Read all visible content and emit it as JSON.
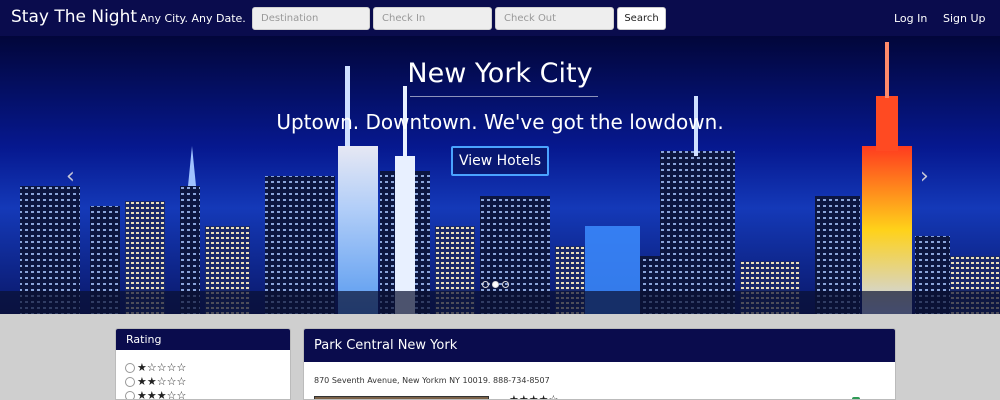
{
  "navbar": {
    "brand": "Stay The Night",
    "tagline": "Any City. Any Date.",
    "destination_placeholder": "Destination",
    "checkin_placeholder": "Check In",
    "checkout_placeholder": "Check Out",
    "search_label": "Search",
    "login_label": "Log In",
    "signup_label": "Sign Up"
  },
  "hero": {
    "title": "New York City",
    "subtitle": "Uptown. Downtown. We've got the lowdown.",
    "button_label": "View Hotels",
    "prev_arrow": "‹",
    "next_arrow": "›",
    "slides_count": 3,
    "active_slide": 1
  },
  "rating_filter": {
    "title": "Rating",
    "options": [
      "★☆☆☆☆",
      "★★☆☆☆",
      "★★★☆☆"
    ]
  },
  "hotel": {
    "name": "Park Central New York",
    "address": "870 Seventh Avenue, New Yorkm NY 10019. 888-734-8507",
    "stars": "★★★★☆"
  },
  "colors": {
    "nav_bg": "#0a0c4d",
    "page_bg": "#cfcfcf",
    "accent_button_border": "#4aa3ff"
  }
}
